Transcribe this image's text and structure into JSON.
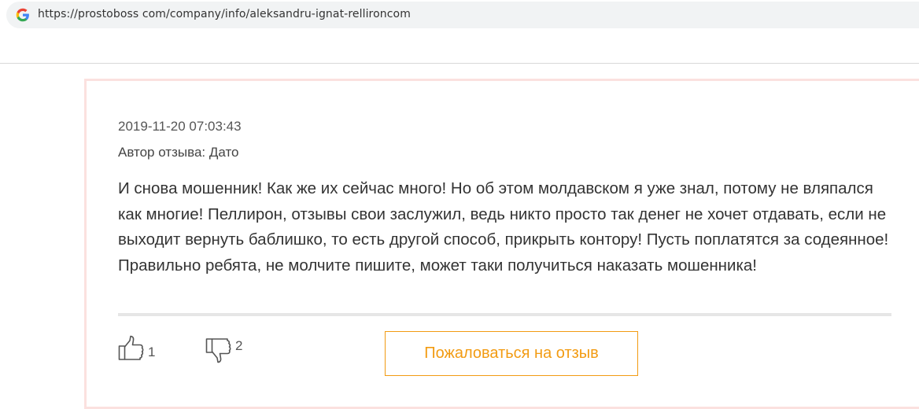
{
  "browser": {
    "url": "https://prostoboss com/company/info/aleksandru-ignat-rellironcom",
    "favicon_icon": "google-g-icon"
  },
  "review": {
    "date": "2019-11-20 07:03:43",
    "author": "Автор отзыва: Дато",
    "text": "И снова мошенник! Как же их сейчас много! Но об этом молдавском я уже знал, потому не вляпался как многие! Пеллирон, отзывы свои заслужил, ведь никто просто так денег не хочет отдавать, если не выходит вернуть баблишко, то есть другой способ, прикрыть контору! Пусть поплатятся за содеянное! Правильно ребята, не молчите пишите, может таки получиться наказать мошенника!",
    "likes": "1",
    "dislikes": "2",
    "like_icon": "thumbs-up-icon",
    "dislike_icon": "thumbs-down-icon",
    "report_label": "Пожаловаться на отзыв"
  },
  "colors": {
    "accent": "#f29b12",
    "card_border": "#fbe1df",
    "address_bar": "#f1f3f4"
  }
}
